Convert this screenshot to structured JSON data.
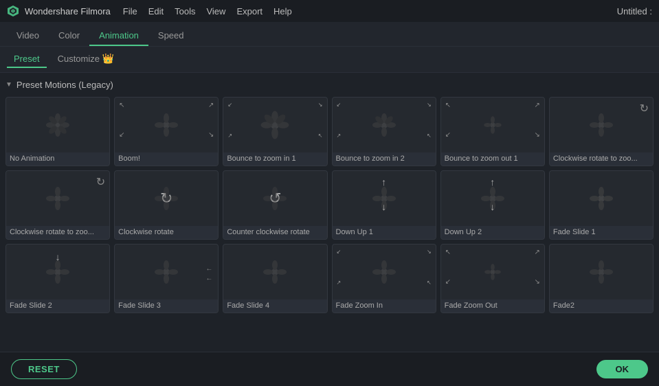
{
  "titleBar": {
    "appName": "Wondershare Filmora",
    "windowTitle": "Untitled :",
    "menuItems": [
      "File",
      "Edit",
      "Tools",
      "View",
      "Export",
      "Help"
    ]
  },
  "tabs": [
    {
      "id": "video",
      "label": "Video"
    },
    {
      "id": "color",
      "label": "Color"
    },
    {
      "id": "animation",
      "label": "Animation",
      "active": true
    },
    {
      "id": "speed",
      "label": "Speed"
    }
  ],
  "subTabs": [
    {
      "id": "preset",
      "label": "Preset",
      "active": true
    },
    {
      "id": "customize",
      "label": "Customize",
      "hasCrown": true
    }
  ],
  "section": {
    "title": "Preset Motions (Legacy)",
    "collapsed": false
  },
  "animations": [
    {
      "id": "no-animation",
      "label": "No Animation",
      "type": "none"
    },
    {
      "id": "boom",
      "label": "Boom!",
      "type": "expand"
    },
    {
      "id": "bounce-zoom-in-1",
      "label": "Bounce to zoom in 1",
      "type": "zoom-in"
    },
    {
      "id": "bounce-zoom-in-2",
      "label": "Bounce to zoom in 2",
      "type": "zoom-in2"
    },
    {
      "id": "bounce-zoom-out-1",
      "label": "Bounce to zoom out 1",
      "type": "zoom-out"
    },
    {
      "id": "clockwise-rotate-zoom",
      "label": "Clockwise rotate to zoo...",
      "type": "rotate-zoom"
    },
    {
      "id": "clockwise-rotate-zoom2",
      "label": "Clockwise rotate to zoo...",
      "type": "rotate-zoom2"
    },
    {
      "id": "clockwise-rotate",
      "label": "Clockwise rotate",
      "type": "rotate"
    },
    {
      "id": "counter-clockwise-rotate",
      "label": "Counter clockwise rotate",
      "type": "counter-rotate"
    },
    {
      "id": "down-up-1",
      "label": "Down Up 1",
      "type": "down-up"
    },
    {
      "id": "down-up-2",
      "label": "Down Up 2",
      "type": "down-up2"
    },
    {
      "id": "fade-slide-1",
      "label": "Fade Slide 1",
      "type": "fade-slide"
    },
    {
      "id": "fade-slide-2",
      "label": "Fade Slide 2",
      "type": "fade-slide2"
    },
    {
      "id": "fade-slide-3",
      "label": "Fade Slide 3",
      "type": "fade-slide3"
    },
    {
      "id": "fade-slide-4",
      "label": "Fade Slide 4",
      "type": "fade-slide4"
    },
    {
      "id": "fade-zoom-in",
      "label": "Fade Zoom In",
      "type": "fade-zoom-in"
    },
    {
      "id": "fade-zoom-out",
      "label": "Fade Zoom Out",
      "type": "fade-zoom-out"
    },
    {
      "id": "fade2",
      "label": "Fade2",
      "type": "fade2"
    }
  ],
  "buttons": {
    "reset": "RESET",
    "ok": "OK"
  }
}
